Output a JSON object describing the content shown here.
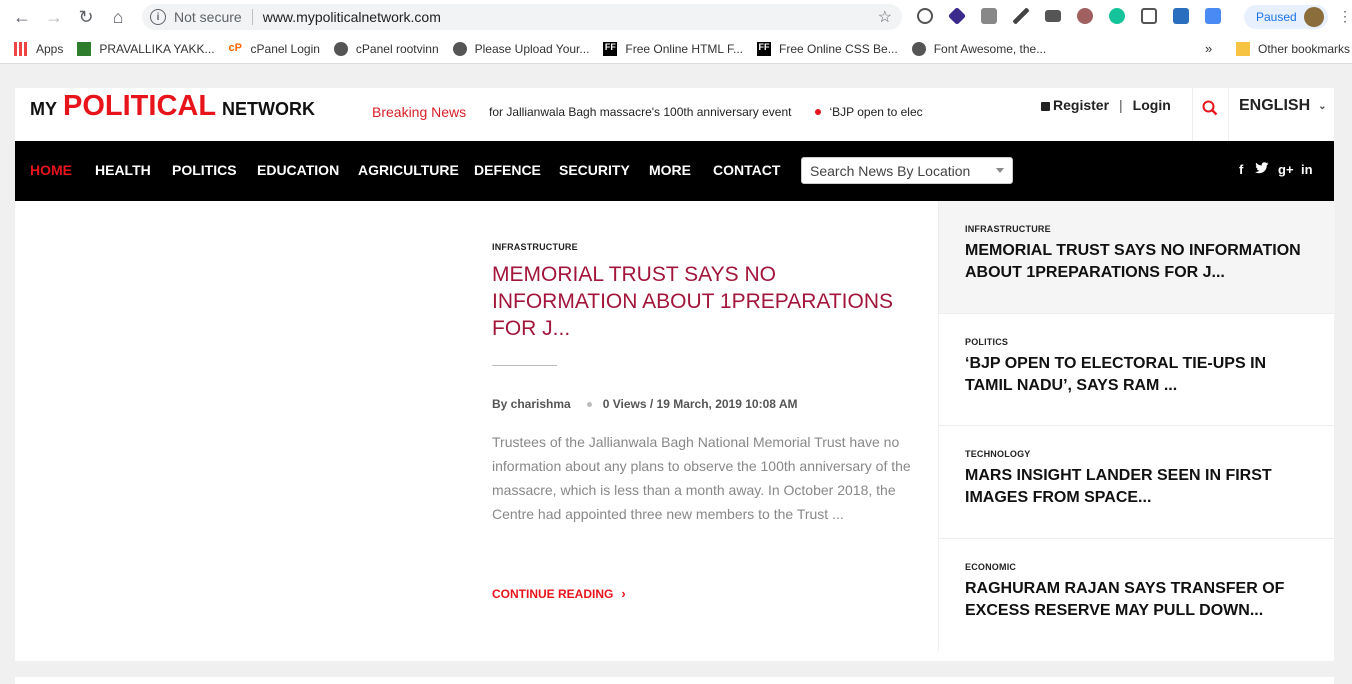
{
  "browser": {
    "not_secure": "Not secure",
    "url": "www.mypoliticalnetwork.com",
    "paused": "Paused",
    "bookmarks": [
      {
        "label": "Apps"
      },
      {
        "label": "PRAVALLIKA YAKK..."
      },
      {
        "label": "cPanel Login"
      },
      {
        "label": "cPanel rootvinn"
      },
      {
        "label": "Please Upload Your..."
      },
      {
        "label": "Free Online HTML F..."
      },
      {
        "label": "Free Online CSS Be..."
      },
      {
        "label": "Font Awesome, the..."
      }
    ],
    "more_bookmarks": "»",
    "other_bookmarks": "Other bookmarks"
  },
  "site": {
    "logo_my": "MY",
    "logo_political": "POLITICAL",
    "logo_network": "NETWORK",
    "breaking_label": "Breaking News",
    "ticker_1": "for Jallianwala Bagh massacre's 100th anniversary event",
    "ticker_2": "‘BJP open to electoral tie-ups in Tamil Nadu’, says Ram",
    "register": "Register",
    "pipe": "|",
    "login": "Login",
    "language": "ENGLISH"
  },
  "nav": {
    "items": [
      "HOME",
      "HEALTH",
      "POLITICS",
      "EDUCATION",
      "AGRICULTURE",
      "DEFENCE",
      "SECURITY",
      "MORE",
      "CONTACT"
    ],
    "search_placeholder": "Search News By Location",
    "social": [
      "f",
      "t",
      "g+",
      "in"
    ]
  },
  "feature": {
    "category": "INFRASTRUCTURE",
    "title": "MEMORIAL TRUST SAYS NO INFORMATION ABOUT 1PREPARATIONS FOR J...",
    "author": "By charishma",
    "meta": "0 Views / 19 March, 2019 10:08 AM",
    "excerpt": "Trustees of the Jallianwala Bagh National Memorial Trust have no information about any plans to observe the 100th anniversary of the massacre, which is less than a month away. In October 2018, the Centre had appointed three new members to the Trust ...",
    "continue": "CONTINUE READING"
  },
  "sidebar": [
    {
      "category": "INFRASTRUCTURE",
      "title": "MEMORIAL TRUST SAYS NO INFORMATION ABOUT 1PREPARATIONS FOR J..."
    },
    {
      "category": "POLITICS",
      "title": "‘BJP OPEN TO ELECTORAL TIE-UPS IN TAMIL NADU’, SAYS RAM ..."
    },
    {
      "category": "TECHNOLOGY",
      "title": "MARS INSIGHT LANDER SEEN IN FIRST IMAGES FROM SPACE..."
    },
    {
      "category": "ECONOMIC",
      "title": "RAGHURAM RAJAN SAYS TRANSFER OF EXCESS RESERVE MAY PULL DOWN..."
    }
  ],
  "colors": {
    "accent": "#e8141b",
    "feature_title": "#a3163b",
    "nav_bg": "#000000"
  }
}
